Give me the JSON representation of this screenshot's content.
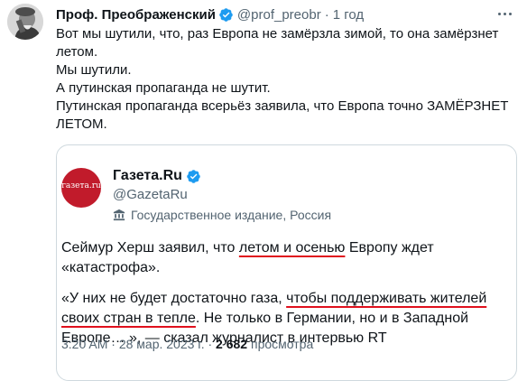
{
  "tweet": {
    "display_name": "Проф. Преображенский",
    "handle": "@prof_preobr",
    "separator": "·",
    "time": "1 год",
    "lines": [
      "Вот мы шутили, что, раз Европа не замёрзла зимой, то она замёрзнет летом.",
      "Мы шутили.",
      "А путинская пропаганда не шутит.",
      "Путинская пропаганда всерьёз заявила, что Европа точно ЗАМЁРЗНЕТ ЛЕТОМ."
    ]
  },
  "quoted": {
    "avatar_text": "газета.ru",
    "display_name": "Газета.Ru",
    "handle": "@GazetaRu",
    "label": "Государственное издание, Россия",
    "label_icon": "building-icon",
    "p1": {
      "a": "Сеймур Херш заявил, что ",
      "u": "летом и осенью",
      "b": " Европу ждет «катастрофа»."
    },
    "p2": {
      "a": "«У них не будет достаточно газа, ",
      "u": "чтобы поддерживать жителей своих стран в тепле",
      "b": ". Не только в Германии, но и в Западной Европе… », — сказал журналист в интервью RT"
    },
    "time": "3:20 AM",
    "separator": "·",
    "date": "28 мар. 2023 г.",
    "views_count": "2 682",
    "views_label": "просмотра"
  },
  "colors": {
    "verified_blue": "#1d9bf0",
    "underline_red": "#e0101d",
    "gazeta_red": "#c11b2b",
    "muted_text": "#536471"
  },
  "icons": {
    "verified": "verified-badge-icon",
    "more": "more-horizontal-icon"
  }
}
